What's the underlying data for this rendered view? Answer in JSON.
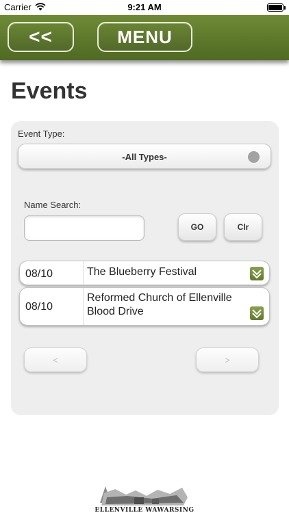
{
  "status_bar": {
    "carrier": "Carrier",
    "time": "9:21 AM"
  },
  "header": {
    "back_label": "<<",
    "menu_label": "MENU",
    "accent_color": "#5d7a2a"
  },
  "page": {
    "title": "Events"
  },
  "filters": {
    "event_type_label": "Event Type:",
    "event_type_value": "-All Types-",
    "name_search_label": "Name Search:",
    "name_search_value": "",
    "go_label": "GO",
    "clear_label": "Clr"
  },
  "events": [
    {
      "date": "08/10",
      "name": "The Blueberry Festival"
    },
    {
      "date": "08/10",
      "name": "Reformed Church of Ellenville Blood Drive"
    }
  ],
  "pager": {
    "prev_label": "<",
    "next_label": ">"
  },
  "footer": {
    "logo_text": "ELLENVILLE WAWARSING"
  },
  "icons": [
    "wifi-icon",
    "battery-icon",
    "radio-dot-icon",
    "chevron-down-icon",
    "logo-icon"
  ]
}
